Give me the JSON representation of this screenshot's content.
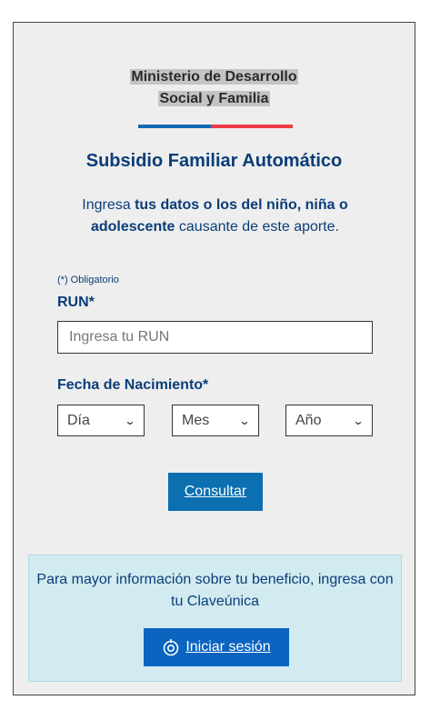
{
  "logo": {
    "line1": "Ministerio de Desarrollo",
    "line2": "Social y Familia"
  },
  "title": "Subsidio Familiar Automático",
  "intro": {
    "part1": "Ingresa ",
    "bold1": "tus datos o los del niño, niña o adolescente",
    "part2": " causante de este aporte."
  },
  "form": {
    "required_note": "(*) Obligatorio",
    "run_label": "RUN*",
    "run_placeholder": "Ingresa tu RUN",
    "date_label": "Fecha de Nacimiento*",
    "day_selected": "Día",
    "month_selected": "Mes",
    "year_selected": "Año",
    "submit_label": "Consultar"
  },
  "info": {
    "text": "Para mayor información sobre tu beneficio, ingresa con tu Claveúnica",
    "login_label": "Iniciar sesión"
  },
  "colors": {
    "primary": "#0b3d78",
    "button": "#0b6fb0",
    "stripe_blue": "#0f69b4",
    "stripe_red": "#eb3c46"
  },
  "icons": {
    "login": "claveunica-icon",
    "dropdown": "chevron-down-icon"
  }
}
